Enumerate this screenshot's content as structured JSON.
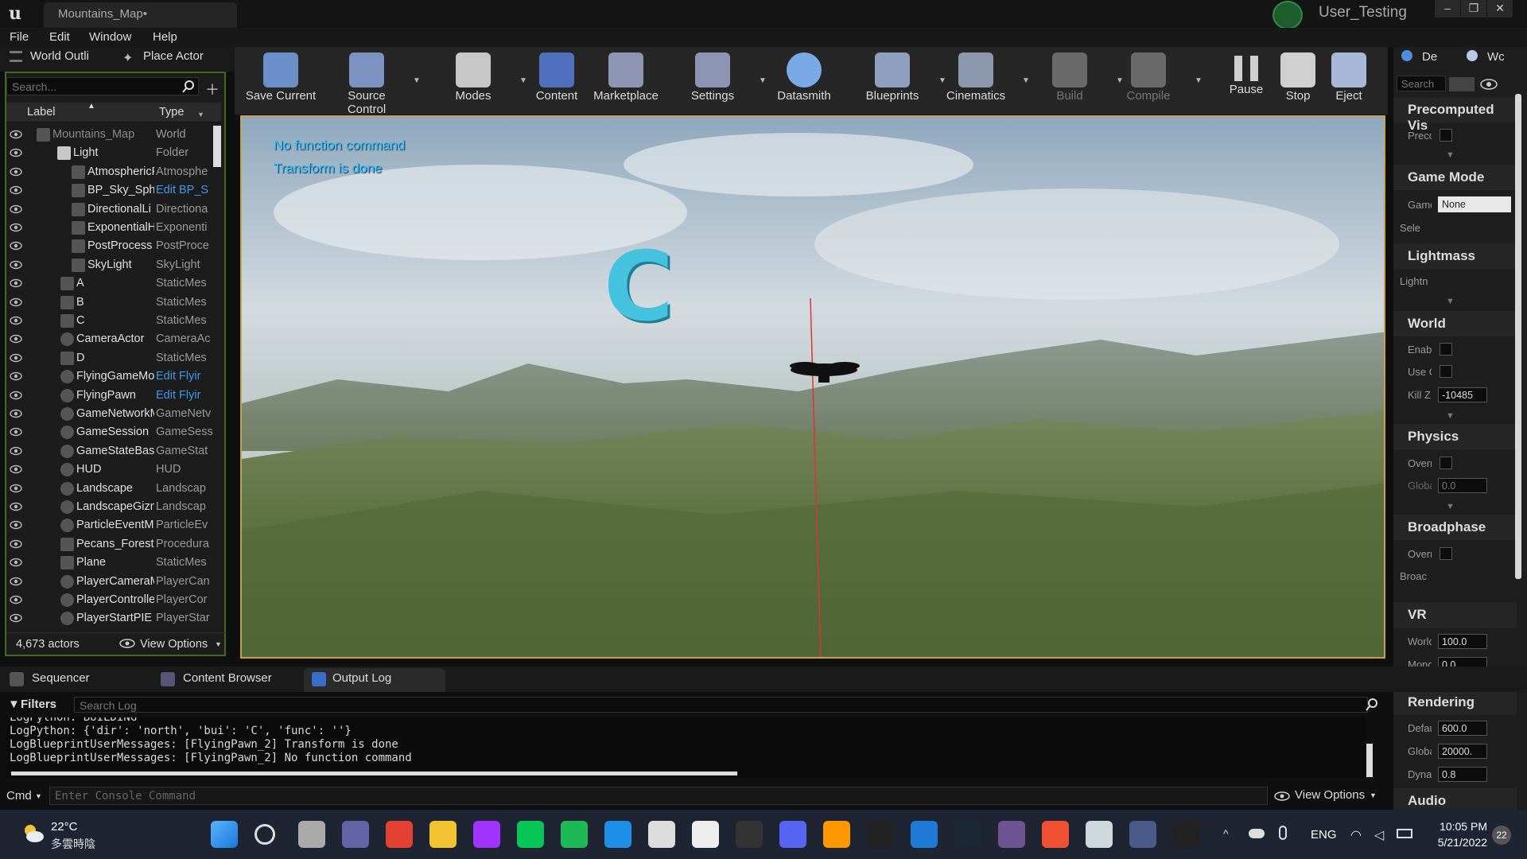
{
  "titlebar": {
    "doc_tab": "Mountains_Map•",
    "user_name": "User_Testing",
    "logo_glyph": "u",
    "minimize": "–",
    "restore": "❐",
    "close": "✕"
  },
  "menu": [
    "File",
    "Edit",
    "Window",
    "Help"
  ],
  "left_tabs": {
    "outliner": "World Outli",
    "place_actor": "Place Actor"
  },
  "outliner": {
    "search_placeholder": "Search...",
    "col_label": "Label",
    "col_type": "Type",
    "rows": [
      {
        "label": "Mountains_Map",
        "type": "World"
      },
      {
        "label": "Light",
        "type": "Folder"
      },
      {
        "label": "AtmosphericF",
        "type": "Atmosphe"
      },
      {
        "label": "BP_Sky_Sph",
        "type": "Edit BP_S"
      },
      {
        "label": "DirectionalLi",
        "type": "Directiona"
      },
      {
        "label": "ExponentialH",
        "type": "Exponenti"
      },
      {
        "label": "PostProcess",
        "type": "PostProce"
      },
      {
        "label": "SkyLight",
        "type": "SkyLight"
      },
      {
        "label": "A",
        "type": "StaticMes"
      },
      {
        "label": "B",
        "type": "StaticMes"
      },
      {
        "label": "C",
        "type": "StaticMes"
      },
      {
        "label": "CameraActor",
        "type": "CameraAc"
      },
      {
        "label": "D",
        "type": "StaticMes"
      },
      {
        "label": "FlyingGameMo",
        "type": "Edit Flyir"
      },
      {
        "label": "FlyingPawn",
        "type": "Edit Flyir"
      },
      {
        "label": "GameNetworkM",
        "type": "GameNetv"
      },
      {
        "label": "GameSession",
        "type": "GameSess"
      },
      {
        "label": "GameStateBas",
        "type": "GameStat"
      },
      {
        "label": "HUD",
        "type": "HUD"
      },
      {
        "label": "Landscape",
        "type": "Landscap"
      },
      {
        "label": "LandscapeGizm",
        "type": "Landscap"
      },
      {
        "label": "ParticleEventM",
        "type": "ParticleEv"
      },
      {
        "label": "Pecans_Forest",
        "type": "Procedura"
      },
      {
        "label": "Plane",
        "type": "StaticMes"
      },
      {
        "label": "PlayerCameraM",
        "type": "PlayerCan"
      },
      {
        "label": "PlayerControlle",
        "type": "PlayerCor"
      },
      {
        "label": "PlayerStartPIE",
        "type": "PlayerStar"
      }
    ],
    "actor_count": "4,673 actors",
    "view_options": "View Options"
  },
  "toolbar": [
    {
      "label": "Save Current",
      "icon": "save-icon"
    },
    {
      "label": "Source Control",
      "icon": "source-control-icon"
    },
    {
      "label": "Modes",
      "icon": "modes-icon"
    },
    {
      "label": "Content",
      "icon": "content-icon"
    },
    {
      "label": "Marketplace",
      "icon": "marketplace-icon"
    },
    {
      "label": "Settings",
      "icon": "settings-icon"
    },
    {
      "label": "Datasmith",
      "icon": "datasmith-icon"
    },
    {
      "label": "Blueprints",
      "icon": "blueprints-icon"
    },
    {
      "label": "Cinematics",
      "icon": "cinematics-icon"
    },
    {
      "label": "Build",
      "icon": "build-icon"
    },
    {
      "label": "Compile",
      "icon": "compile-icon"
    },
    {
      "label": "Pause",
      "icon": "pause-icon"
    },
    {
      "label": "Stop",
      "icon": "stop-icon"
    },
    {
      "label": "Eject",
      "icon": "eject-icon"
    }
  ],
  "viewport": {
    "messages": [
      "No function command",
      "Transform is done"
    ],
    "floating_letter": "C"
  },
  "right_panel": {
    "tabs": [
      "De",
      "Wc"
    ],
    "search_placeholder": "Search",
    "sections": {
      "precomputed": {
        "title": "Precomputed Vis",
        "props": [
          "Precc"
        ]
      },
      "game_mode": {
        "title": "Game Mode",
        "game_label": "Game",
        "game_value": "None",
        "select_label": "Sele"
      },
      "lightmass": {
        "title": "Lightmass",
        "props": [
          "Lightn"
        ]
      },
      "world": {
        "title": "World",
        "props": [
          "Enabl",
          "Use C",
          "Kill Z"
        ],
        "kill_z": "-10485"
      },
      "physics": {
        "title": "Physics",
        "props": [
          "Overr",
          "Globa"
        ],
        "globa": "0.0"
      },
      "broadphase": {
        "title": "Broadphase",
        "props": [
          "Overr",
          "Broac"
        ]
      },
      "vr": {
        "title": "VR",
        "props": [
          "Worlc",
          "Mono"
        ],
        "world_scale": "100.0",
        "mono": "0.0"
      },
      "rendering": {
        "title": "Rendering",
        "props": [
          "Defau",
          "Globa",
          "Dyna"
        ],
        "defau": "600.0",
        "globa": "20000.",
        "dyna": "0.8"
      },
      "audio": {
        "title": "Audio"
      }
    }
  },
  "bottom_tabs": [
    "Sequencer",
    "Content Browser",
    "Output Log"
  ],
  "log": {
    "filters": "Filters",
    "search_placeholder": "Search Log",
    "lines": [
      "LogPython: BUILDING",
      "LogPython: {'dir': 'north', 'bui': 'C', 'func': ''}",
      "LogBlueprintUserMessages: [FlyingPawn_2] Transform is done",
      "LogBlueprintUserMessages: [FlyingPawn_2] No function command"
    ]
  },
  "console": {
    "cmd_label": "Cmd",
    "placeholder": "Enter Console Command",
    "view_options": "View Options"
  },
  "taskbar": {
    "weather_temp": "22°C",
    "weather_desc": "多雲時陰",
    "lang": "ENG",
    "time": "10:05 PM",
    "date": "5/21/2022",
    "notif_count": "22",
    "app_icons": [
      "windows-start-icon",
      "search-icon",
      "task-view-icon",
      "teams-chat-icon",
      "chrome-icon",
      "file-explorer-icon",
      "messenger-icon",
      "line-icon",
      "spotify-icon",
      "edge-icon",
      "inkscape-icon",
      "widget-icon",
      "epic-games-icon",
      "discord-icon",
      "sublime-icon",
      "terminal-icon",
      "vscode-icon",
      "steam-icon",
      "github-icon",
      "git-icon",
      "notepad-icon",
      "vr-icon",
      "unreal-engine-icon"
    ],
    "colors": {
      "accent": "#1f2433"
    }
  }
}
